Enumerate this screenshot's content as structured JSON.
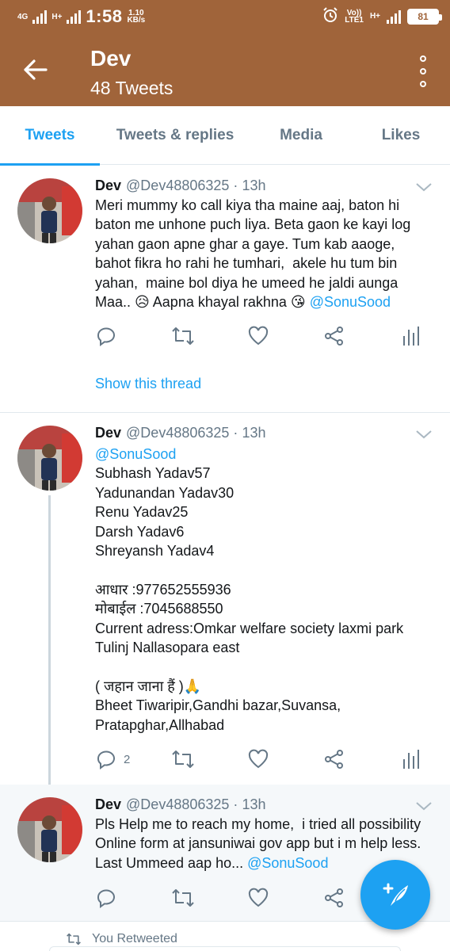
{
  "status_bar": {
    "network_left": "4G",
    "network_hplus": "H+",
    "time": "1:58",
    "speed_value": "1.10",
    "speed_unit": "KB/s",
    "volte": "Vo))",
    "lte": "LTE1",
    "network_right": "H+",
    "battery": "81"
  },
  "profile": {
    "name": "Dev",
    "tweet_count": "48 Tweets"
  },
  "tabs": [
    {
      "label": "Tweets",
      "active": true
    },
    {
      "label": "Tweets & replies",
      "active": false
    },
    {
      "label": "Media",
      "active": false
    },
    {
      "label": "Likes",
      "active": false
    }
  ],
  "tweets": [
    {
      "name": "Dev",
      "handle": "@Dev48806325",
      "separator": "·",
      "time": "13h",
      "body": "Meri mummy ko call kiya tha maine aaj, baton hi baton me unhone puch liya. Beta gaon ke kayi log yahan gaon apne ghar a gaye. Tum kab aaoge, bahot fikra ho rahi he tumhari,  akele hu tum bin yahan,  maine bol diya he umeed he jaldi aunga Maa.. 😥 Aapna khayal rakhna 😘 ",
      "mention": "@SonuSood",
      "reply_count": "",
      "show_thread": "Show this thread"
    },
    {
      "name": "Dev",
      "handle": "@Dev48806325",
      "separator": "·",
      "time": "13h",
      "mention": "@SonuSood",
      "body": "Subhash Yadav57\nYadunandan Yadav30\nRenu Yadav25\nDarsh Yadav6\nShreyansh Yadav4\n\nआधार :977652555936\nमोबाईल :7045688550\nCurrent adress:Omkar welfare society laxmi park Tulinj Nallasopara east\n\n( जहान जाना हैं )🙏\nBheet Tiwaripir,Gandhi bazar,Suvansa, Pratapghar,Allhabad",
      "reply_count": "2"
    },
    {
      "name": "Dev",
      "handle": "@Dev48806325",
      "separator": "·",
      "time": "13h",
      "body": "Pls Help me to reach my home,  i tried all possibility Online form at jansuniwai gov app but i m help less. Last Ummeed aap ho... ",
      "mention": "@SonuSood",
      "reply_count": ""
    }
  ],
  "retweet_context": "You Retweeted",
  "icons": {
    "back": "arrow-left-icon",
    "more": "more-vertical-icon",
    "reply": "reply-icon",
    "retweet": "retweet-icon",
    "like": "heart-icon",
    "share": "share-icon",
    "analytics": "analytics-icon",
    "caret": "chevron-down-icon",
    "fab": "compose-tweet-icon"
  },
  "colors": {
    "header": "#a0643a",
    "accent": "#1da1f2",
    "muted": "#657786"
  }
}
